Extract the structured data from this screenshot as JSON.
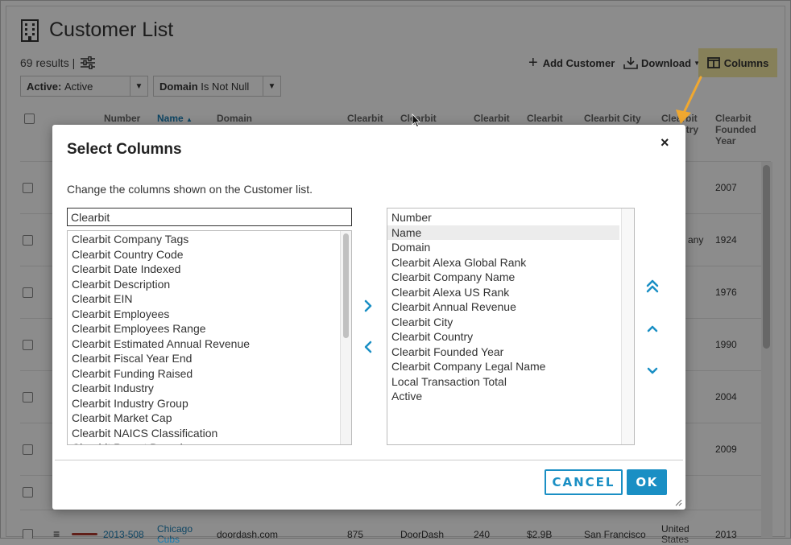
{
  "page": {
    "title": "Customer List",
    "results_text": "69 results |",
    "filters": [
      {
        "label": "Active:",
        "value": "Active"
      },
      {
        "label": "Domain",
        "value": "Is Not Null"
      }
    ],
    "toolbar": {
      "add_customer": "Add Customer",
      "download": "Download",
      "columns": "Columns"
    }
  },
  "table": {
    "headers": {
      "number": "Number",
      "name": "Name",
      "domain": "Domain",
      "cb1": "Clearbit",
      "cb2": "Clearbit",
      "cb3": "Clearbit",
      "cb4": "Clearbit",
      "city": "Clearbit City",
      "country_a": "Clearbit",
      "country_b": "Country",
      "founded_a": "Clearbit",
      "founded_b": "Founded",
      "founded_c": "Year"
    },
    "visible_cells": {
      "r1_year": "2007",
      "r2_partial": "any",
      "r2_year": "1924",
      "r3_year": "1976",
      "r4_year": "1990",
      "r5_year": "2004",
      "r6_year": "2009",
      "last_number": "2013-508",
      "last_name_a": "Chicago",
      "last_name_b": "Cubs",
      "last_domain": "doordash.com",
      "last_cb1": "875",
      "last_cb2": "DoorDash",
      "last_cb3": "240",
      "last_cb4": "$2.9B",
      "last_city": "San Francisco",
      "last_country_a": "United",
      "last_country_b": "States",
      "last_year": "2013"
    }
  },
  "modal": {
    "title": "Select Columns",
    "close": "×",
    "description": "Change the columns shown on the Customer list.",
    "search_value": "Clearbit",
    "available": [
      "Clearbit Company Tags",
      "Clearbit Country Code",
      "Clearbit Date Indexed",
      "Clearbit Description",
      "Clearbit EIN",
      "Clearbit Employees",
      "Clearbit Employees Range",
      "Clearbit Estimated Annual Revenue",
      "Clearbit Fiscal Year End",
      "Clearbit Funding Raised",
      "Clearbit Industry",
      "Clearbit Industry Group",
      "Clearbit Market Cap",
      "Clearbit NAICS Classification",
      "Clearbit Parent Domain"
    ],
    "selected": [
      "Number",
      "Name",
      "Domain",
      "Clearbit Alexa Global Rank",
      "Clearbit Company Name",
      "Clearbit Alexa US Rank",
      "Clearbit Annual Revenue",
      "Clearbit City",
      "Clearbit Country",
      "Clearbit Founded Year",
      "Clearbit Company Legal Name",
      "Local Transaction Total",
      "Active"
    ],
    "cancel_label": "CANCEL",
    "ok_label": "OK"
  },
  "icons": {
    "building": "building-icon",
    "filter_settings": "sliders-icon",
    "add": "plus-icon",
    "download": "download-icon",
    "columns": "columns-icon",
    "move_right": "chevron-right-icon",
    "move_left": "chevron-left-icon",
    "move_top": "double-chevron-up-icon",
    "move_up": "chevron-up-icon",
    "move_down": "chevron-down-icon"
  },
  "colors": {
    "accent": "#1a8fc4",
    "columns_highlight": "#f5e9a3",
    "annotation_arrow": "#f0a830"
  }
}
